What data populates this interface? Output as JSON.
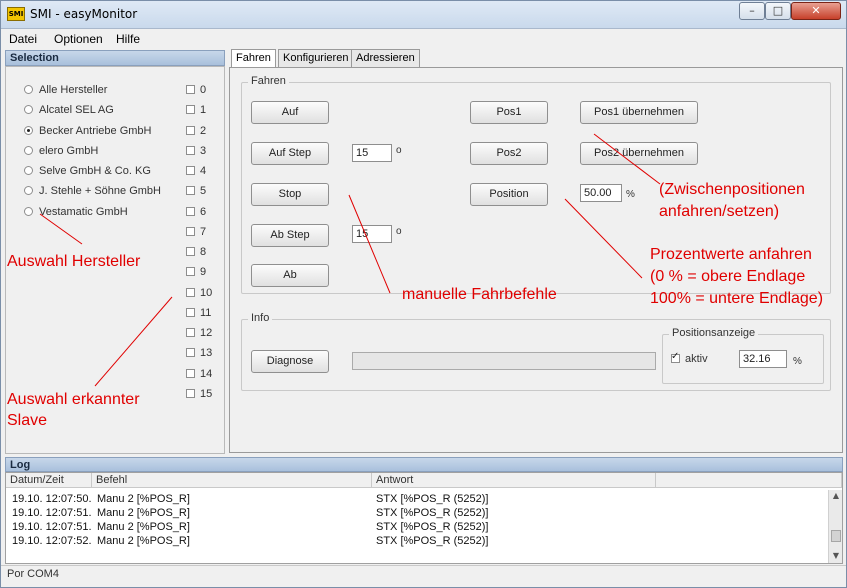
{
  "window": {
    "title": "SMI - easyMonitor",
    "app_icon": "SMI"
  },
  "window_controls": {
    "minimize": "–",
    "maximize": "□",
    "close": "✕"
  },
  "menu": {
    "items": [
      "Datei",
      "Optionen",
      "Hilfe"
    ]
  },
  "selection": {
    "header": "Selection",
    "manufacturers": [
      {
        "label": "Alle Hersteller",
        "selected": false
      },
      {
        "label": "Alcatel SEL AG",
        "selected": false
      },
      {
        "label": "Becker Antriebe GmbH",
        "selected": true
      },
      {
        "label": "elero GmbH",
        "selected": false
      },
      {
        "label": "Selve GmbH & Co. KG",
        "selected": false
      },
      {
        "label": "J. Stehle + Söhne GmbH",
        "selected": false
      },
      {
        "label": "Vestamatic GmbH",
        "selected": false
      }
    ],
    "slaves": [
      "0",
      "1",
      "2",
      "3",
      "4",
      "5",
      "6",
      "7",
      "8",
      "9",
      "10",
      "11",
      "12",
      "13",
      "14",
      "15"
    ]
  },
  "tabs": [
    "Fahren",
    "Konfigurieren",
    "Adressieren"
  ],
  "fahren": {
    "group_title": "Fahren",
    "auf": "Auf",
    "auf_step": "Auf Step",
    "auf_step_value": "15",
    "stop": "Stop",
    "ab_step": "Ab Step",
    "ab_step_value": "15",
    "ab": "Ab",
    "step_unit": "o",
    "pos1": "Pos1",
    "pos1_take": "Pos1 übernehmen",
    "pos2": "Pos2",
    "pos2_take": "Pos2 übernehmen",
    "position": "Position",
    "position_value": "50.00",
    "percent": "%"
  },
  "info": {
    "group_title": "Info",
    "diagnose": "Diagnose",
    "position_display": {
      "title": "Positionsanzeige",
      "aktiv_label": "aktiv",
      "aktiv_checked": true,
      "value": "32.16",
      "unit": "%"
    }
  },
  "log": {
    "header": "Log",
    "columns": [
      "Datum/Zeit",
      "Befehl",
      "Antwort"
    ],
    "rows": [
      [
        "19.10. 12:07:50...",
        "Manu 2 [%POS_R]",
        "STX [%POS_R (5252)]"
      ],
      [
        "19.10. 12:07:51...",
        "Manu 2 [%POS_R]",
        "STX [%POS_R (5252)]"
      ],
      [
        "19.10. 12:07:51...",
        "Manu 2 [%POS_R]",
        "STX [%POS_R (5252)]"
      ],
      [
        "19.10. 12:07:52...",
        "Manu 2 [%POS_R]",
        "STX [%POS_R (5252)]"
      ]
    ]
  },
  "status": {
    "port": "Por COM4"
  },
  "annotations": {
    "hersteller": "Auswahl Hersteller",
    "slave_line1": "Auswahl erkannter",
    "slave_line2": "Slave",
    "fahrbefehle": "manuelle Fahrbefehle",
    "zwischen_line1": "(Zwischenpositionen",
    "zwischen_line2": "anfahren/setzen)",
    "prozent_line1": "Prozentwerte anfahren",
    "prozent_line2": "(0 % = obere Endlage",
    "prozent_line3": "100% = untere Endlage)",
    "color": "#e00000"
  }
}
